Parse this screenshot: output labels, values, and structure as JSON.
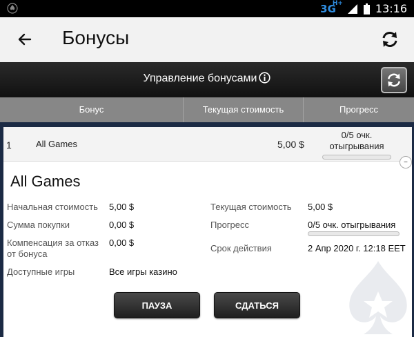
{
  "status_bar": {
    "network": "3G",
    "network_sup": "H+",
    "time": "13:16"
  },
  "app_bar": {
    "title": "Бонусы"
  },
  "section": {
    "title": "Управление бонусами"
  },
  "columns": [
    "Бонус",
    "Текущая стоимость",
    "Прогресс"
  ],
  "bonus_row": {
    "number": "1",
    "name": "All Games",
    "current_cost": "5,00 $",
    "progress_text": "0/5 очк. отыгрывания",
    "progress_value": 0
  },
  "detail": {
    "title": "All Games",
    "initial_cost_label": "Начальная стоимость",
    "initial_cost_value": "5,00 $",
    "purchase_label": "Сумма покупки",
    "purchase_value": "0,00 $",
    "refusal_label": "Компенсация за отказ от бонуса",
    "refusal_value": "0,00 $",
    "games_label": "Доступные игры",
    "games_value": "Все игры казино",
    "current_cost_label": "Текущая стоимость",
    "current_cost_value": "5,00 $",
    "progress_label": "Прогресс",
    "progress_value_text": "0/5 очк. отыгрывания",
    "progress_value": 0,
    "expiry_label": "Срок действия",
    "expiry_value": "2 Апр 2020 г. 12:18 EET"
  },
  "buttons": {
    "pause": "ПАУЗА",
    "surrender": "СДАТЬСЯ"
  },
  "colors": {
    "network": "#2f8de0",
    "column_header_bg": "#878787",
    "background": "#1b2a44"
  }
}
